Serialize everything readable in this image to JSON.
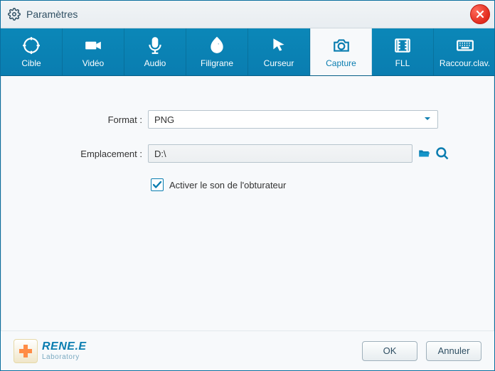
{
  "window": {
    "title": "Paramètres"
  },
  "tabs": [
    {
      "id": "cible",
      "label": "Cible"
    },
    {
      "id": "video",
      "label": "Vidéo"
    },
    {
      "id": "audio",
      "label": "Audio"
    },
    {
      "id": "filigrane",
      "label": "Filigrane"
    },
    {
      "id": "curseur",
      "label": "Curseur"
    },
    {
      "id": "capture",
      "label": "Capture"
    },
    {
      "id": "fll",
      "label": "FLL"
    },
    {
      "id": "raccourci",
      "label": "Raccour.clav."
    }
  ],
  "form": {
    "format_label": "Format :",
    "format_value": "PNG",
    "location_label": "Emplacement :",
    "location_value": "D:\\",
    "shutter_label": "Activer le son de l'obturateur",
    "shutter_checked": true
  },
  "logo": {
    "line1": "RENE.E",
    "line2": "Laboratory"
  },
  "buttons": {
    "ok": "OK",
    "cancel": "Annuler"
  },
  "colors": {
    "accent": "#0a7db0",
    "close": "#e22b1d"
  }
}
